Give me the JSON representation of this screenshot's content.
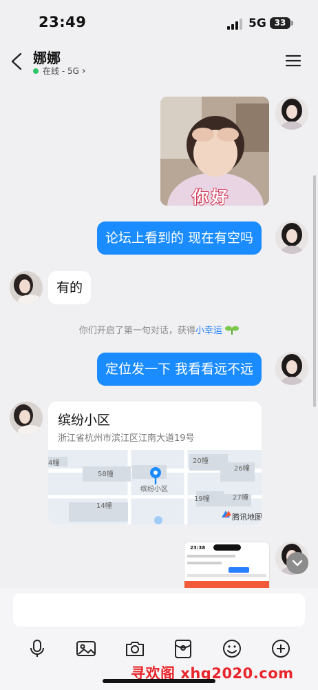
{
  "status_bar": {
    "time": "23:49",
    "network": "5G",
    "battery": "33"
  },
  "header": {
    "name": "娜娜",
    "presence": "在线 - 5G"
  },
  "messages": {
    "sticker_text": "你好",
    "msg1": "论坛上看到的 现在有空吗",
    "reply1": "有的",
    "system_text": "你们开启了第一句对话，获得",
    "system_link": "小幸运",
    "msg2": "定位发一下 我看看远不远",
    "location": {
      "title": "缤纷小区",
      "address": "浙江省杭州市滨江区江南大道19号",
      "map_labels": [
        "20幢",
        "26幢",
        "58幢",
        "缤纷小区",
        "19幢",
        "27幢",
        "14幢",
        "4幢"
      ],
      "map_brand": "腾讯地图"
    },
    "shot_time": "23:38"
  },
  "watermark": "寻欢阁 xhg2020.com",
  "icons": [
    "back-icon",
    "menu-icon",
    "mic-icon",
    "image-icon",
    "camera-icon",
    "red-packet-icon",
    "emoji-icon",
    "plus-icon",
    "chevron-down-icon"
  ]
}
